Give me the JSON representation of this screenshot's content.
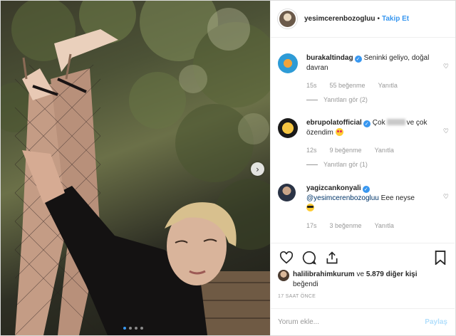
{
  "header": {
    "username": "yesimcerenbozogluu",
    "separator": "•",
    "follow_label": "Takip Et"
  },
  "comments": [
    {
      "user": "burakaltindag",
      "verified": true,
      "text": "Seninki geliyo, doğal davran",
      "time": "15s",
      "likes": "55 beğenme",
      "reply": "Yanıtla",
      "view_replies": "Yanıtları gör (2)"
    },
    {
      "user": "ebrupolatofficial",
      "verified": true,
      "text_before": "Çok",
      "text_after": "ve çok özendim",
      "time": "12s",
      "likes": "9 beğenme",
      "reply": "Yanıtla",
      "view_replies": "Yanıtları gör (1)"
    },
    {
      "user": "yagizcankonyali",
      "verified": true,
      "mention": "@yesimcerenbozogluu",
      "text": "Eee neyse",
      "time": "17s",
      "likes": "3 beğenme",
      "reply": "Yanıtla"
    }
  ],
  "likes": {
    "user": "halilibrahimkurum",
    "rest": " ve ",
    "count": "5.879 diğer kişi",
    "suffix": "beğendi"
  },
  "timestamp": "17 SAAT ÖNCE",
  "comment_box": {
    "placeholder": "Yorum ekle...",
    "post_label": "Paylaş"
  },
  "carousel": {
    "active_index": 0,
    "total": 4
  },
  "colors": {
    "accent": "#3897f0",
    "muted": "#999999",
    "text": "#262626"
  }
}
